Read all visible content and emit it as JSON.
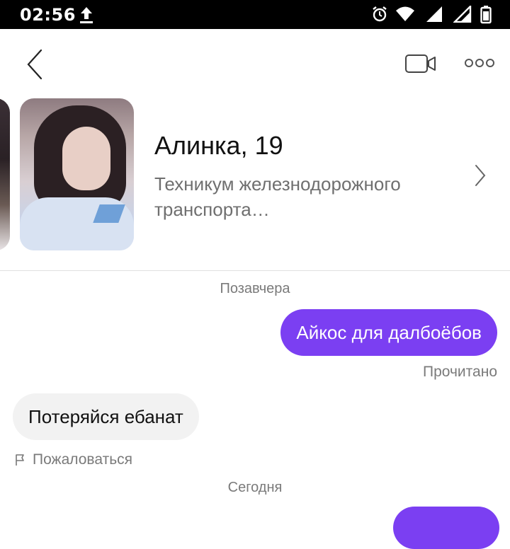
{
  "status_bar": {
    "time": "02:56",
    "icons": [
      "upload-icon",
      "alarm-icon",
      "wifi-icon",
      "signal-icon",
      "signal-icon",
      "battery-icon"
    ]
  },
  "header": {
    "icons": [
      "back-chevron-icon",
      "video-call-icon",
      "more-icon"
    ]
  },
  "profile": {
    "name_age": "Алинка, 19",
    "description": "Техникум железнодорожного транспорта…"
  },
  "chat": {
    "date_1": "Позавчера",
    "outgoing_1": "Айкос для далбоёбов",
    "read_status": "Прочитано",
    "incoming_1": "Потеряйся ебанат",
    "report_label": "Пожаловаться",
    "date_2": "Сегодня"
  },
  "colors": {
    "accent": "#7b3ff2",
    "incoming_bubble": "#f2f2f2",
    "status_bar": "#000000"
  }
}
